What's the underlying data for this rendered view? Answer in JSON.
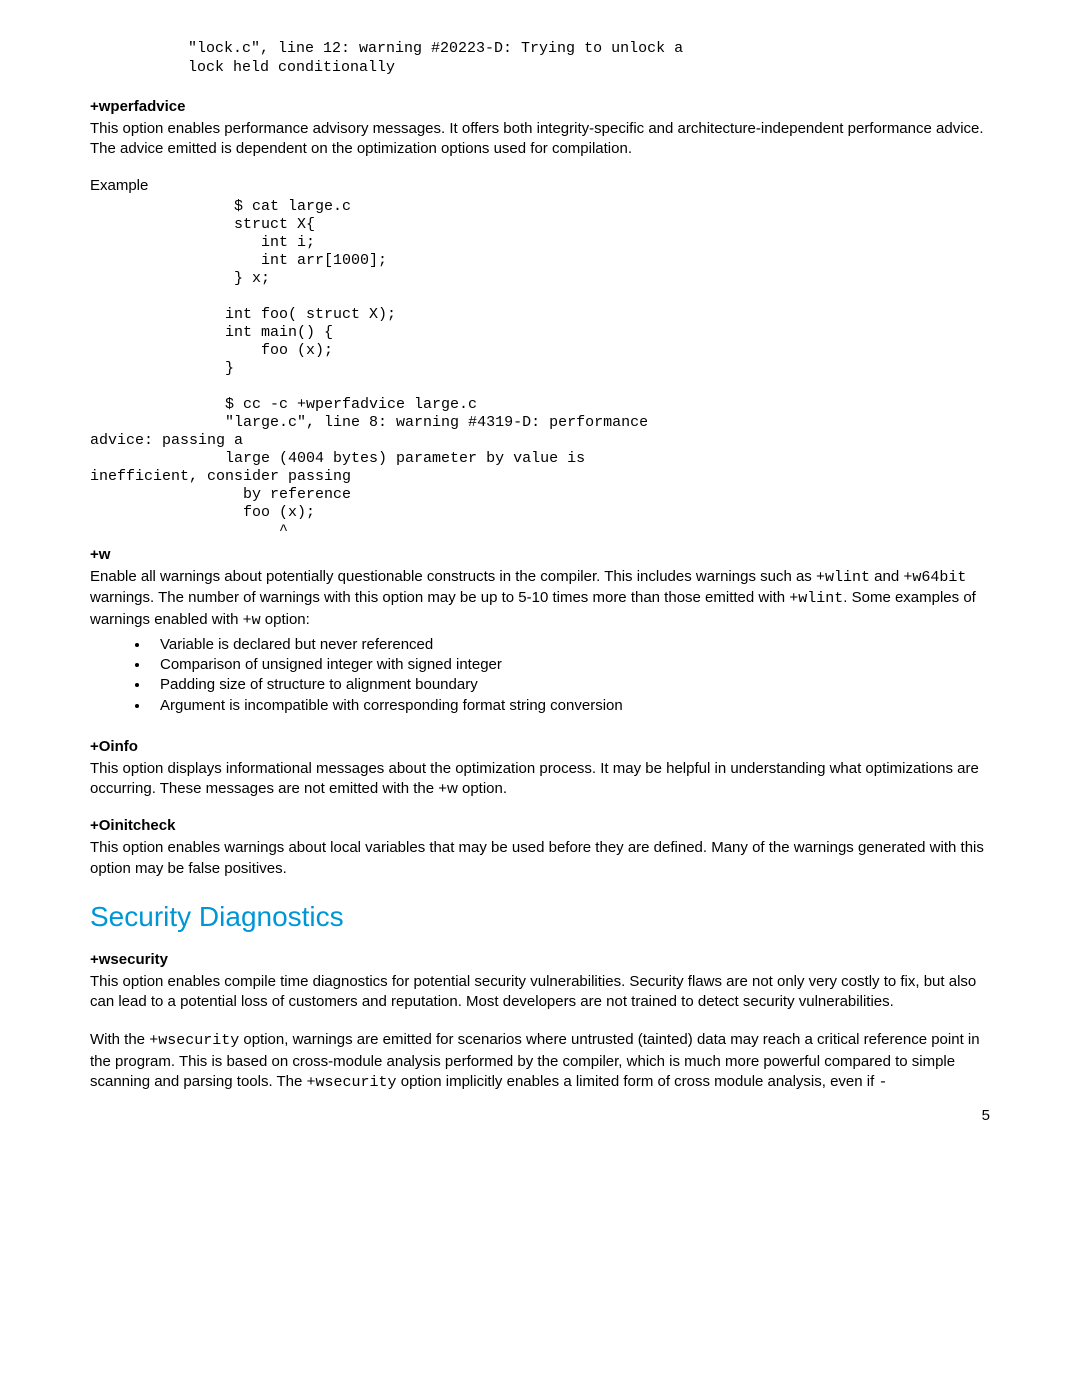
{
  "code_top": "\"lock.c\", line 12: warning #20223-D: Trying to unlock a\nlock held conditionally",
  "wperfadvice": {
    "heading": "+wperfadvice",
    "para": "This option enables performance advisory messages. It offers both integrity-specific and architecture-independent performance advice. The advice emitted is dependent on the optimization options used for compilation.",
    "example_label": "Example",
    "code": "                $ cat large.c\n                struct X{\n                   int i;\n                   int arr[1000];\n                } x;\n\n               int foo( struct X);\n               int main() {\n                   foo (x);\n               }\n\n               $ cc -c +wperfadvice large.c\n               \"large.c\", line 8: warning #4319-D: performance\nadvice: passing a\n               large (4004 bytes) parameter by value is\ninefficient, consider passing\n                 by reference\n                 foo (x);\n                     ^"
  },
  "w": {
    "heading": "+w",
    "para_pre1": "Enable all warnings about potentially questionable constructs in the compiler. This includes warnings such as ",
    "code1": "+wlint",
    "mid1": " and ",
    "code2": "+w64bit",
    "mid2": " warnings. The number of warnings with this option may be up to 5-10 times more than those emitted with ",
    "code3": "+wlint",
    "mid3": ". Some examples of warnings enabled with ",
    "code4": "+w",
    "post": " option:",
    "bullets": [
      "Variable is declared but never referenced",
      "Comparison of unsigned integer with signed integer",
      "Padding size of structure to alignment boundary",
      "Argument is incompatible with corresponding format string conversion"
    ]
  },
  "oinfo": {
    "heading": "+Oinfo",
    "para": "This option displays informational messages about the optimization process. It may be helpful in understanding what optimizations are occurring. These messages are not emitted with the +w option."
  },
  "oinitcheck": {
    "heading": "+Oinitcheck",
    "para": "This option enables warnings about local variables that may be used before they are defined.  Many of the warnings generated with this option may be false positives."
  },
  "security": {
    "h1": "Security Diagnostics",
    "heading": "+wsecurity",
    "para1": "This option enables compile time diagnostics for potential security vulnerabilities. Security flaws are not only very costly to fix, but also can lead to a potential loss of customers and reputation. Most developers are not trained to detect security vulnerabilities.",
    "para2_pre": "With the ",
    "para2_code1": "+wsecurity",
    "para2_mid1": " option, warnings are emitted for scenarios where untrusted (tainted) data may reach a critical reference point in the program. This is based on cross-module analysis performed by the compiler, which is much more powerful compared to simple scanning and parsing tools. The ",
    "para2_code2": "+wsecurity",
    "para2_mid2": " option implicitly enables a limited form of cross module analysis, even if ",
    "para2_code3": "-"
  },
  "page_number": "5"
}
